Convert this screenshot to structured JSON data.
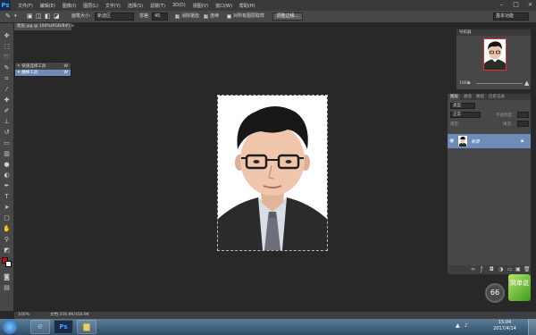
{
  "menubar": {
    "logo": "Ps",
    "items": [
      "文件(F)",
      "编辑(E)",
      "图像(I)",
      "图层(L)",
      "文字(Y)",
      "选择(S)",
      "滤镜(T)",
      "3D(D)",
      "视图(V)",
      "窗口(W)",
      "帮助(H)"
    ],
    "minimize": "–",
    "maximize": "□",
    "close": "×"
  },
  "options": {
    "brush_size_label": "画笔大小:",
    "brush_size_value": "9",
    "mode_value": "新选区",
    "feather_label": "容差:",
    "feather_value": "45",
    "antialias_label": "消除锯齿",
    "contiguous_label": "连续",
    "sample_all_label": "对所有图层取样",
    "refine_edge_label": "调整边缘...",
    "workspace_value": "基本功能"
  },
  "document": {
    "tab_label": "图层.jpg @ 100%(RGB/8#) ×"
  },
  "flyout": {
    "items": [
      {
        "label": "快速选择工具",
        "key": "W"
      },
      {
        "label": "魔棒工具",
        "key": "W"
      }
    ]
  },
  "navigator": {
    "title": "导航器",
    "zoom": "100%"
  },
  "layers": {
    "tabs": [
      "图层",
      "通道",
      "路径",
      "历史记录"
    ],
    "kind_label": "类型",
    "blend_mode": "正常",
    "opacity_label": "不透明度:",
    "lock_label": "锁定:",
    "fill_label": "填充:",
    "layer_name": "背景"
  },
  "statusbar": {
    "zoom": "100%",
    "doc_info": "文档:356.9K/356.9K"
  },
  "taskbar": {
    "time": "15:04",
    "date": "2017/4/14"
  },
  "overlays": {
    "speed_value": "66",
    "logo_text": "简单说"
  }
}
